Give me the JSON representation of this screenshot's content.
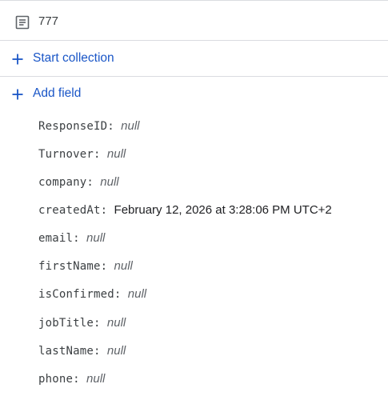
{
  "document": {
    "title": "777",
    "icon": "document-icon"
  },
  "actions": {
    "start_collection": "Start collection",
    "add_field": "Add field"
  },
  "fields": [
    {
      "key": "ResponseID",
      "value": "null",
      "is_null": true
    },
    {
      "key": "Turnover",
      "value": "null",
      "is_null": true
    },
    {
      "key": "company",
      "value": "null",
      "is_null": true
    },
    {
      "key": "createdAt",
      "value": "February 12, 2026 at 3:28:06 PM UTC+2",
      "is_null": false
    },
    {
      "key": "email",
      "value": "null",
      "is_null": true
    },
    {
      "key": "firstName",
      "value": "null",
      "is_null": true
    },
    {
      "key": "isConfirmed",
      "value": "null",
      "is_null": true
    },
    {
      "key": "jobTitle",
      "value": "null",
      "is_null": true
    },
    {
      "key": "lastName",
      "value": "null",
      "is_null": true
    },
    {
      "key": "phone",
      "value": "null",
      "is_null": true
    }
  ],
  "colors": {
    "accent": "#1a56c7",
    "divider": "#dadce0",
    "text": "#202124",
    "muted": "#5f6368"
  }
}
